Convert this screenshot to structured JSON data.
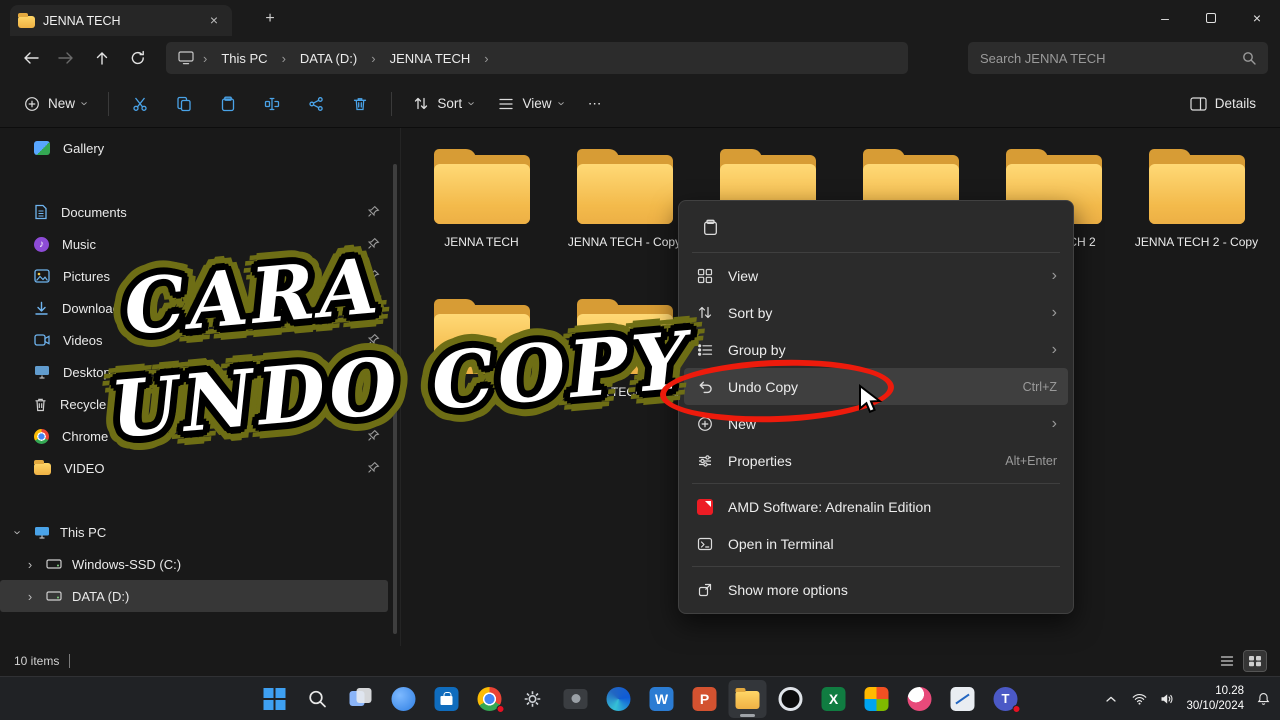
{
  "colors": {
    "window_bg": "#191919",
    "chrome_bg": "#1b1b1b",
    "menu_bg": "#2b2b2b",
    "folder_yellow": "#f3ba4b",
    "annotation_red": "#ed1b0c",
    "overlay_fill": "#ffffff",
    "overlay_outline": "#000000",
    "overlay_glow": "#6e6e15",
    "taskbar_bg": "#202225"
  },
  "titlebar": {
    "tab_title": "JENNA TECH",
    "close_tab": "×",
    "new_tab": "+",
    "minimize": "–",
    "close": "×"
  },
  "navbar": {
    "crumb_this_pc": "This PC",
    "crumb_drive": "DATA (D:)",
    "crumb_folder": "JENNA TECH",
    "search_placeholder": "Search JENNA TECH"
  },
  "toolbar": {
    "new_label": "New",
    "sort_label": "Sort",
    "view_label": "View",
    "more_label": "⋯",
    "details_label": "Details"
  },
  "sidebar": {
    "items": [
      {
        "label": "Gallery",
        "pinned": false
      },
      {
        "label": "Documents",
        "pinned": true
      },
      {
        "label": "Music",
        "pinned": true
      },
      {
        "label": "Pictures",
        "pinned": true
      },
      {
        "label": "Downloads",
        "pinned": true
      },
      {
        "label": "Videos",
        "pinned": true
      },
      {
        "label": "Desktop",
        "pinned": true
      },
      {
        "label": "Recycle Bin",
        "pinned": true
      },
      {
        "label": "Chrome",
        "pinned": true
      },
      {
        "label": "VIDEO",
        "pinned": true
      }
    ],
    "tree_root": "This PC",
    "tree_children": [
      {
        "label": "Windows-SSD (C:)",
        "selected": false
      },
      {
        "label": "DATA (D:)",
        "selected": true
      }
    ]
  },
  "files": [
    {
      "label": "JENNA TECH"
    },
    {
      "label": "JENNA TECH - Copy"
    },
    {
      "label": ""
    },
    {
      "label": ""
    },
    {
      "label": "JENNA TECH 2"
    },
    {
      "label": "JENNA TECH 2 - Copy"
    },
    {
      "label": ""
    },
    {
      "label": "JENNA TECH 3 - Co"
    },
    {
      "label": ""
    },
    {
      "label": ""
    }
  ],
  "context_menu": {
    "items": [
      {
        "label": "View",
        "submenu": true
      },
      {
        "label": "Sort by",
        "submenu": true
      },
      {
        "label": "Group by",
        "submenu": true
      },
      {
        "label": "Undo Copy",
        "shortcut": "Ctrl+Z",
        "highlighted": true
      },
      {
        "label": "New",
        "submenu": true
      },
      {
        "label": "Properties",
        "shortcut": "Alt+Enter"
      },
      {
        "label": "AMD Software: Adrenalin Edition"
      },
      {
        "label": "Open in Terminal"
      },
      {
        "label": "Show more options"
      }
    ]
  },
  "statusbar": {
    "count": "10 items"
  },
  "taskbar": {
    "time": "10.28",
    "date": "30/10/2024",
    "icons": [
      "start",
      "search",
      "task-view",
      "widgets",
      "microsoft-store",
      "chrome",
      "settings",
      "camera",
      "edge",
      "word",
      "powerpoint",
      "file-explorer",
      "obs",
      "excel",
      "photos",
      "paint",
      "snipping-tool",
      "teams"
    ]
  },
  "overlay": {
    "line1": "CARA",
    "line2": "UNDO COPY"
  }
}
